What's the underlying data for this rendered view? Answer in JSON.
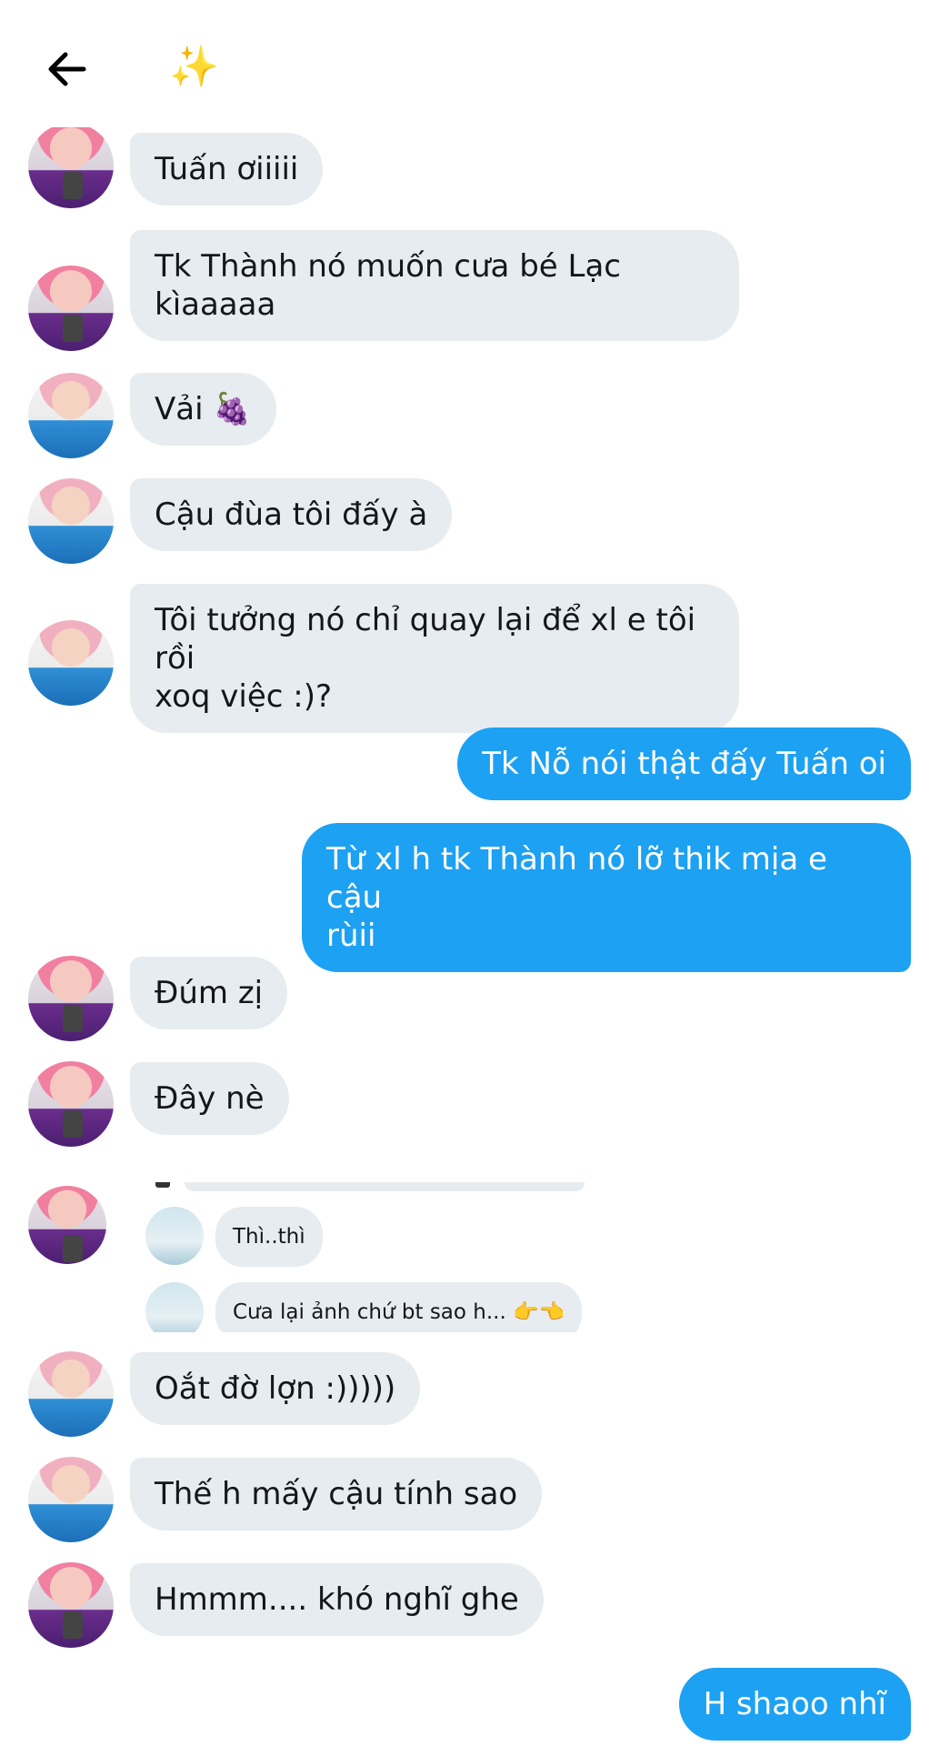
{
  "header": {
    "back_icon": "arrow-left-icon",
    "title_emoji": "✨"
  },
  "messages": [
    {
      "text": "Tuấn ơiiiii"
    },
    {
      "text": "Tk Thành nó muốn cưa bé Lạc\nkìaaaaa"
    },
    {
      "text": "Vải 🍇"
    },
    {
      "text": "Cậu đùa tôi đấy à"
    },
    {
      "text": "Tôi tưởng nó chỉ quay lại để xl e tôi rồi\nxoq việc :)?"
    },
    {
      "text": "Tk Nỗ nói thật đấy Tuấn oi"
    },
    {
      "text": "Từ xl h tk Thành nó lỡ thik mịa e cậu\nrùii"
    },
    {
      "text": "Đúm zị"
    },
    {
      "text": "Đây nè"
    },
    {
      "text": "Oắt đờ lợn :)))))"
    },
    {
      "text": "Thế h mấy cậu tính sao"
    },
    {
      "text": "Hmmm.... khó nghĩ ghe"
    },
    {
      "text": "H shaoo nhĩ"
    }
  ],
  "quoted": [
    {
      "text": "Thì..thì"
    },
    {
      "text": "Cưa lại ảnh chứ bt sao h... 👉👈"
    }
  ]
}
